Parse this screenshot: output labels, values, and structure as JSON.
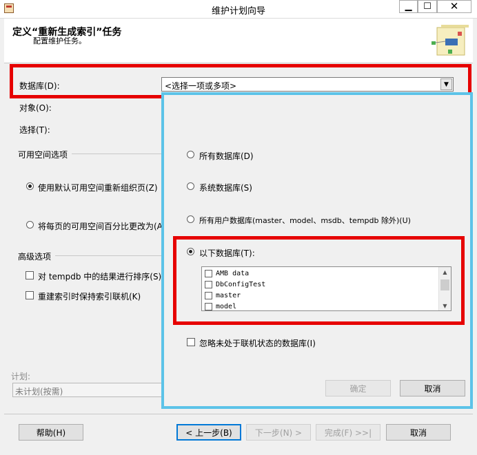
{
  "window": {
    "title": "维护计划向导"
  },
  "header": {
    "title": "定义“重新生成索引”任务",
    "subtitle": "配置维护任务。"
  },
  "database": {
    "label": "数据库(D):",
    "value": "<选择一项或多项>"
  },
  "form": {
    "object_label": "对象(O):",
    "selection_label": "选择(T):",
    "free_space_group": "可用空间选项",
    "free_space_default": "使用默认可用空间重新组织页(Z)",
    "free_space_percent": "将每页的可用空间百分比更改为(A",
    "advanced_group": "高级选项",
    "sort_tempdb": "对 tempdb 中的结果进行排序(S)",
    "keep_online": "重建索引时保持索引联机(K)"
  },
  "schedule": {
    "label": "计划:",
    "value": "未计划(按需)"
  },
  "popup": {
    "options": [
      {
        "label": "所有数据库(D)",
        "selected": false
      },
      {
        "label": "系统数据库(S)",
        "selected": false
      },
      {
        "label": "所有用户数据库(master、model、msdb、tempdb 除外)(U)",
        "selected": false
      },
      {
        "label": "以下数据库(T):",
        "selected": true
      }
    ],
    "databases": [
      "AMB data",
      "DbConfigTest",
      "master",
      "model"
    ],
    "ignore_offline": "忽略未处于联机状态的数据库(I)",
    "ok_label": "确定",
    "cancel_label": "取消"
  },
  "footer": {
    "help": "帮助(H)",
    "back": "< 上一步(B)",
    "next": "下一步(N) >",
    "finish": "完成(F) >>|",
    "cancel": "取消"
  },
  "colors": {
    "highlight_red": "#e60000",
    "popup_border": "#5cc3e8",
    "focus_blue": "#0078d7"
  }
}
